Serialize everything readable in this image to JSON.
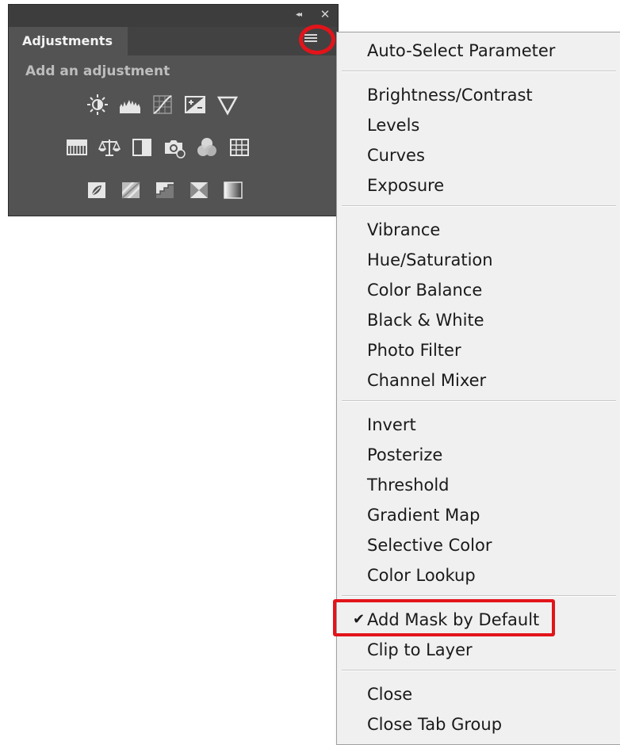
{
  "panel": {
    "tab_label": "Adjustments",
    "subtitle": "Add an adjustment",
    "collapse_glyph": "◂◂",
    "close_glyph": "✕",
    "icons_row1": [
      "brightness-contrast-icon",
      "levels-icon",
      "curves-icon",
      "exposure-icon",
      "vibrance-icon"
    ],
    "icons_row2": [
      "hue-saturation-icon",
      "color-balance-icon",
      "black-white-icon",
      "photo-filter-icon",
      "channel-mixer-icon",
      "color-lookup-icon"
    ],
    "icons_row3": [
      "invert-icon",
      "posterize-icon",
      "threshold-icon",
      "selective-color-icon",
      "gradient-map-icon"
    ]
  },
  "menu": {
    "checkmark": "✔",
    "items": [
      "Auto-Select Parameter",
      "Brightness/Contrast",
      "Levels",
      "Curves",
      "Exposure",
      "Vibrance",
      "Hue/Saturation",
      "Color Balance",
      "Black & White",
      "Photo Filter",
      "Channel Mixer",
      "Invert",
      "Posterize",
      "Threshold",
      "Gradient Map",
      "Selective Color",
      "Color Lookup",
      "Add Mask by Default",
      "Clip to Layer",
      "Close",
      "Close Tab Group"
    ],
    "checked_item": "Add Mask by Default"
  },
  "colors": {
    "panel_bg": "#535353",
    "menu_bg": "#f0f0f0",
    "highlight_red": "#e2141a"
  }
}
